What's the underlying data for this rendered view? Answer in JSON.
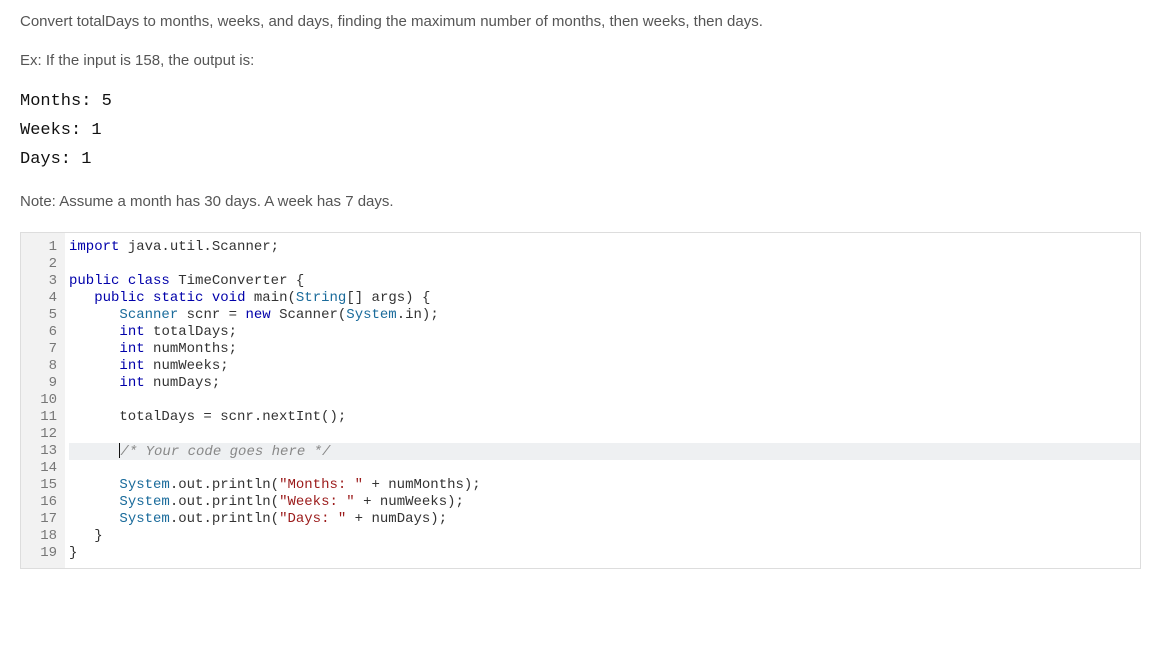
{
  "instruction_text": "Convert totalDays to months, weeks, and days, finding the maximum number of months, then weeks, then days.",
  "example_intro": "Ex: If the input is 158, the output is:",
  "example_output": "Months: 5\nWeeks: 1\nDays: 1",
  "note_text": "Note: Assume a month has 30 days. A week has 7 days.",
  "line_count": 19,
  "active_line": 13,
  "code": {
    "l1": {
      "kw1": "import",
      "rest": " java.util.Scanner;"
    },
    "l2": "",
    "l3": {
      "kw1": "public",
      "kw2": "class",
      "cls": "TimeConverter",
      "rest": " {"
    },
    "l4": {
      "indent": "   ",
      "kw1": "public",
      "kw2": "static",
      "kw3": "void",
      "name": "main",
      "paren": "(",
      "type1": "String",
      "brackets": "[]",
      "arg": " args",
      "close": ") {"
    },
    "l5": {
      "indent": "      ",
      "type1": "Scanner",
      "mid": " scnr = ",
      "kw1": "new",
      "ctor": " Scanner(",
      "type2": "System",
      "rest": ".in);"
    },
    "l6": {
      "indent": "      ",
      "kw1": "int",
      "rest": " totalDays;"
    },
    "l7": {
      "indent": "      ",
      "kw1": "int",
      "rest": " numMonths;"
    },
    "l8": {
      "indent": "      ",
      "kw1": "int",
      "rest": " numWeeks;"
    },
    "l9": {
      "indent": "      ",
      "kw1": "int",
      "rest": " numDays;"
    },
    "l10": "",
    "l11": "      totalDays = scnr.nextInt();",
    "l12": "",
    "l13": {
      "indent": "      ",
      "cmt": "/* Your code goes here */"
    },
    "l14": "",
    "l15": {
      "indent": "      ",
      "type1": "System",
      "mid": ".out.println(",
      "str": "\"Months: \"",
      "rest": " + numMonths);"
    },
    "l16": {
      "indent": "      ",
      "type1": "System",
      "mid": ".out.println(",
      "str": "\"Weeks: \"",
      "rest": " + numWeeks);"
    },
    "l17": {
      "indent": "      ",
      "type1": "System",
      "mid": ".out.println(",
      "str": "\"Days: \"",
      "rest": " + numDays);"
    },
    "l18": "   }",
    "l19": "}"
  }
}
